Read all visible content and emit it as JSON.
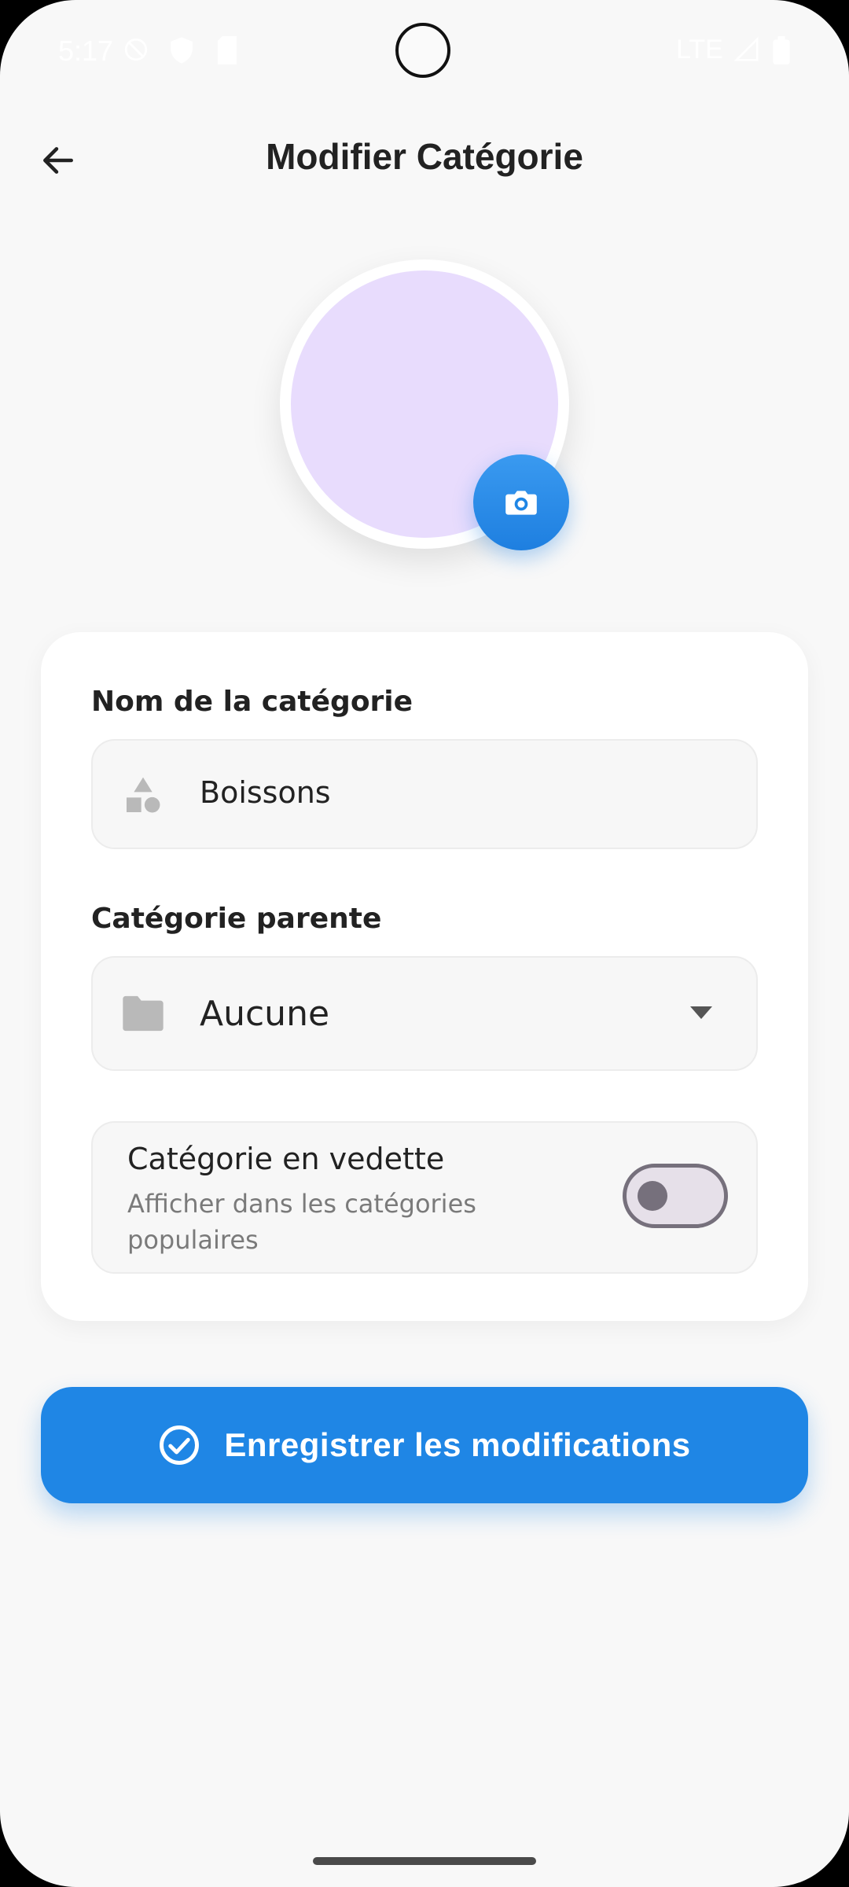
{
  "status_bar": {
    "time": "5:17",
    "network": "LTE"
  },
  "header": {
    "title": "Modifier Catégorie",
    "back_icon": "arrow-left-icon"
  },
  "avatar": {
    "placeholder_color": "#e8dcfd",
    "camera_icon": "camera-icon"
  },
  "form": {
    "name": {
      "label": "Nom de la catégorie",
      "value": "Boissons",
      "icon": "category-shapes-icon"
    },
    "parent": {
      "label": "Catégorie parente",
      "value": "Aucune",
      "icon": "folder-icon"
    },
    "featured": {
      "title": "Catégorie en vedette",
      "subtitle": "Afficher dans les catégories populaires",
      "enabled": false
    }
  },
  "save_button": {
    "label": "Enregistrer les modifications",
    "icon": "check-circle-icon"
  },
  "colors": {
    "accent": "#1f86e5",
    "background": "#f8f8f8",
    "card": "#ffffff",
    "avatar": "#e8dcfd"
  }
}
